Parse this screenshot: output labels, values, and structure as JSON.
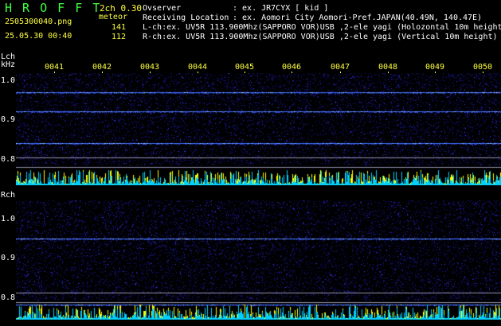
{
  "header": {
    "brand": "H R O F F T",
    "version": "2ch 0.30",
    "filename": "2505300040.png",
    "datetime": "25.05.30 00:40",
    "meteor_label": "meteor",
    "lch_count": "141",
    "rch_count": "112",
    "observer_key": "Ovserver",
    "observer_val": ": ex. JR7CYX [ kid ]",
    "location_key": "Receiving Location",
    "location_val": ": ex. Aomori City Aomori-Pref.JAPAN(40.49N, 140.47E)",
    "lch_info": "L-ch:ex. UV5R 113.900Mhz(SAPPORO VOR)USB ,2-ele yagi (Holozontal 10m height)",
    "rch_info": "R-ch:ex. UV5R 113.900Mhz(SAPPORO VOR)USB ,2-ele yagi (Vertical 10m height)"
  },
  "lch": {
    "label": "Lch",
    "unit": "kHz",
    "y_ticks": [
      "1.0",
      "0.9",
      "0.8"
    ]
  },
  "rch": {
    "label": "Rch",
    "y_ticks": [
      "1.0",
      "0.9",
      "0.8"
    ]
  },
  "time_ticks": [
    "0041",
    "0042",
    "0043",
    "0044",
    "0045",
    "0046",
    "0047",
    "0048",
    "0049",
    "0050"
  ],
  "colors": {
    "brand": "#40ff40",
    "accent": "#ffff40",
    "noise_blue": "#1a1aa0",
    "carrier": "#4080ff",
    "level_yellow": "#ffff00",
    "level_cyan": "#00e0ff"
  }
}
